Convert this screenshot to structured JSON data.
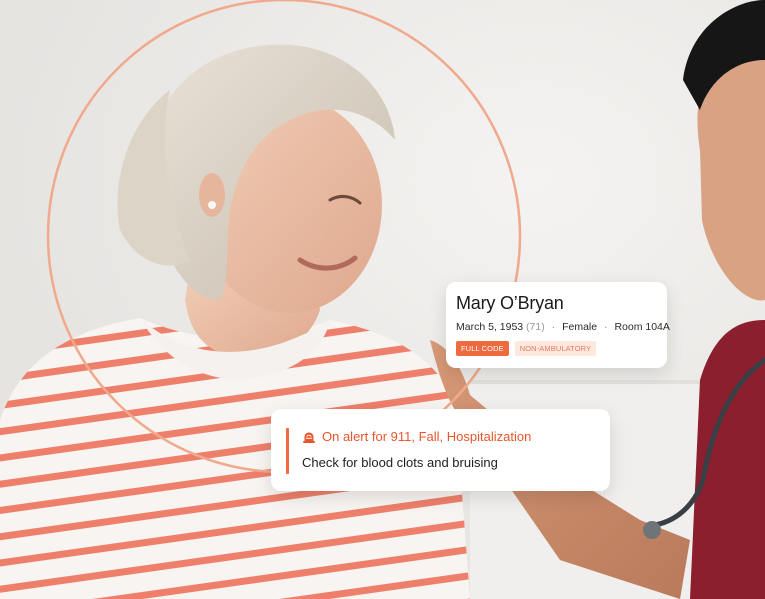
{
  "patient": {
    "name": "Mary O’Bryan",
    "birthdate": "March 5, 1953",
    "age": "(71)",
    "sex": "Female",
    "room": "Room 104A",
    "separator": "·",
    "badges": {
      "full_code": "FULL CODE",
      "non_ambulatory": "NON-AMBULATORY"
    }
  },
  "alert": {
    "title": "On alert for 911, Fall, Hospitalization",
    "note": "Check for blood clots and bruising",
    "icon": "alarm-light-icon"
  },
  "colors": {
    "accent": "#ef6b3f",
    "accent_light": "#fde8e0",
    "ring": "#f0a98d"
  }
}
